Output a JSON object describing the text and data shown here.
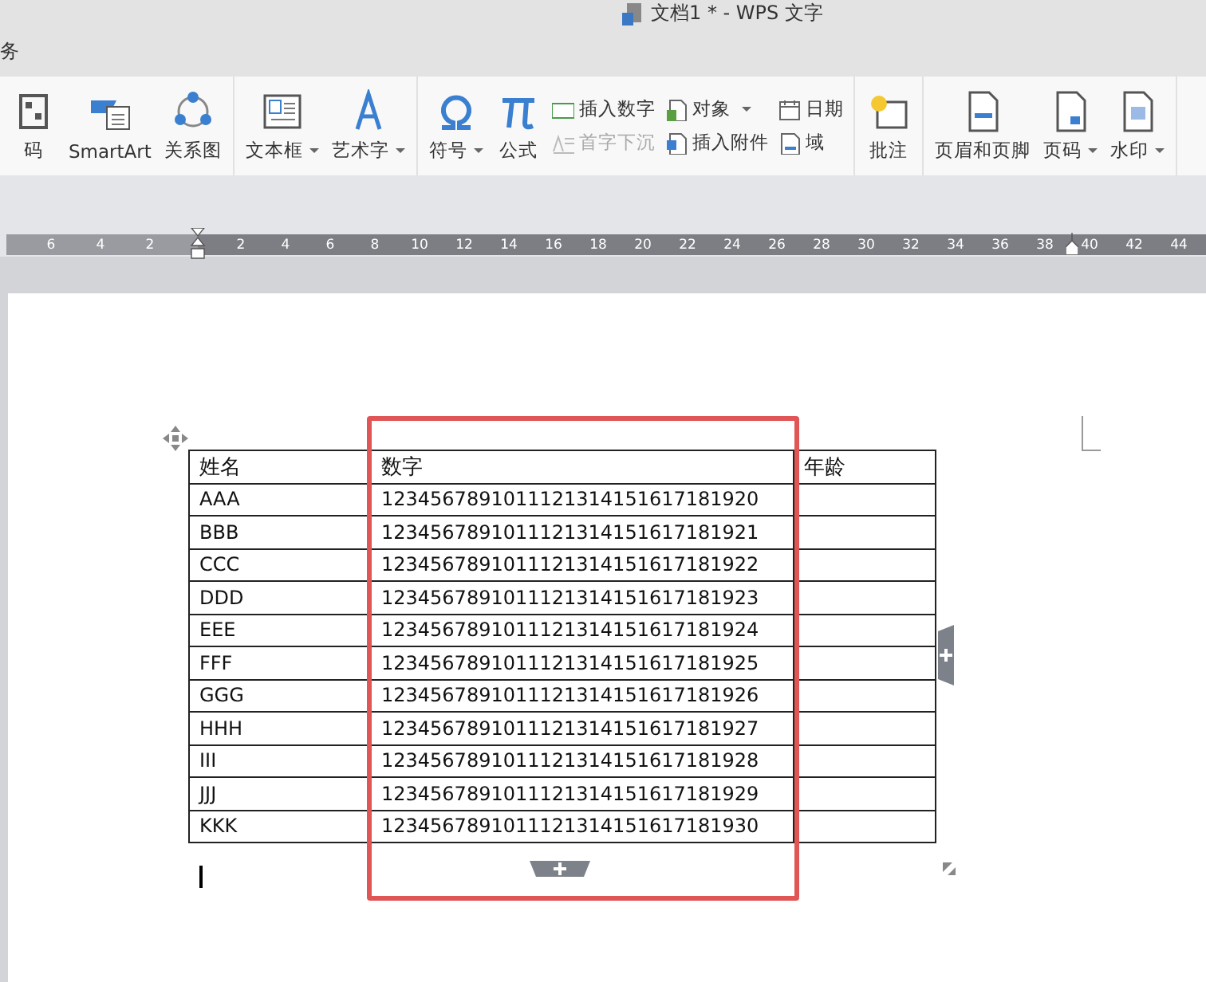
{
  "window": {
    "title": "文档1 * - WPS 文字"
  },
  "menu_item": "务",
  "ribbon": {
    "groups": [
      {
        "items": [
          {
            "kind": "large",
            "label": "码",
            "dropdown": false
          },
          {
            "kind": "large",
            "label": "SmartArt",
            "dropdown": false
          },
          {
            "kind": "large",
            "label": "关系图",
            "dropdown": false
          }
        ]
      },
      {
        "items": [
          {
            "kind": "large",
            "label": "文本框",
            "dropdown": true
          },
          {
            "kind": "large",
            "label": "艺术字",
            "dropdown": true
          }
        ]
      },
      {
        "items": [
          {
            "kind": "large",
            "label": "符号",
            "dropdown": true
          },
          {
            "kind": "large",
            "label": "公式",
            "dropdown": false
          },
          {
            "kind": "stack",
            "items": [
              {
                "label": "插入数字",
                "dropdown": false,
                "disabled": false
              },
              {
                "label": "首字下沉",
                "dropdown": false,
                "disabled": true
              }
            ]
          },
          {
            "kind": "stack",
            "items": [
              {
                "label": "对象",
                "dropdown": true,
                "disabled": false
              },
              {
                "label": "插入附件",
                "dropdown": false,
                "disabled": false
              }
            ]
          },
          {
            "kind": "stack",
            "items": [
              {
                "label": "日期",
                "dropdown": false,
                "disabled": false
              },
              {
                "label": "域",
                "dropdown": false,
                "disabled": false
              }
            ]
          }
        ]
      },
      {
        "items": [
          {
            "kind": "large",
            "label": "批注",
            "dropdown": false
          }
        ]
      },
      {
        "items": [
          {
            "kind": "large",
            "label": "页眉和页脚",
            "dropdown": false
          },
          {
            "kind": "large",
            "label": "页码",
            "dropdown": true
          },
          {
            "kind": "large",
            "label": "水印",
            "dropdown": true
          }
        ]
      }
    ]
  },
  "ruler": {
    "left_labels": [
      "6",
      "4",
      "2"
    ],
    "right_labels": [
      "2",
      "4",
      "6",
      "8",
      "10",
      "12",
      "14",
      "16",
      "18",
      "20",
      "22",
      "24",
      "26",
      "28",
      "30",
      "32",
      "34",
      "36",
      "38",
      "40",
      "42",
      "44"
    ]
  },
  "table": {
    "columns": [
      "姓名",
      "数字",
      "年龄"
    ],
    "rows": [
      [
        "AAA",
        "1234567891011121314151617181920"
      ],
      [
        "BBB",
        "1234567891011121314151617181921"
      ],
      [
        "CCC",
        "1234567891011121314151617181922"
      ],
      [
        "DDD",
        "1234567891011121314151617181923"
      ],
      [
        "EEE",
        "1234567891011121314151617181924"
      ],
      [
        "FFF",
        "1234567891011121314151617181925"
      ],
      [
        "GGG",
        "1234567891011121314151617181926"
      ],
      [
        "HHH",
        "1234567891011121314151617181927"
      ],
      [
        "III",
        "1234567891011121314151617181928"
      ],
      [
        "JJJ",
        "1234567891011121314151617181929"
      ],
      [
        "KKK",
        "1234567891011121314151617181930"
      ]
    ]
  }
}
